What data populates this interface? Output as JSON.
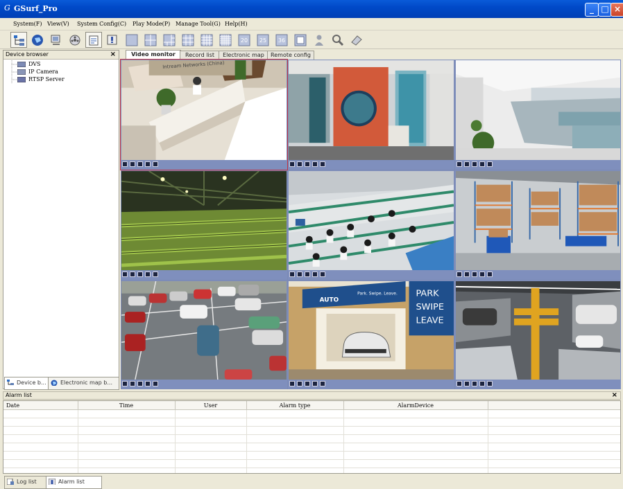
{
  "window": {
    "title": "GSurf_Pro",
    "controls": [
      "minimize",
      "maximize",
      "close"
    ]
  },
  "menu": {
    "items": [
      "System(F)",
      "View(V)",
      "System Config(C)",
      "Play Mode(P)",
      "Manage Tool(G)",
      "Help(H)"
    ]
  },
  "toolbar": {
    "buttons": [
      {
        "icon": "device-tree-icon"
      },
      {
        "icon": "globe-icon"
      },
      {
        "icon": "monitor-icon"
      },
      {
        "icon": "film-reel-icon"
      },
      {
        "icon": "config-icon"
      },
      {
        "icon": "alarm-panel-icon"
      },
      {
        "icon": "layout-1-icon"
      },
      {
        "icon": "layout-4-icon"
      },
      {
        "icon": "layout-6-icon"
      },
      {
        "icon": "layout-9-icon"
      },
      {
        "icon": "layout-16-icon"
      },
      {
        "icon": "layout-20-icon",
        "label": "20"
      },
      {
        "icon": "layout-25-icon",
        "label": "25"
      },
      {
        "icon": "layout-36-icon",
        "label": "36"
      },
      {
        "icon": "fullscreen-icon"
      },
      {
        "icon": "person-icon"
      },
      {
        "icon": "search-icon"
      },
      {
        "icon": "eraser-icon"
      }
    ]
  },
  "device_browser": {
    "title": "Device browser",
    "close": "×",
    "tree": [
      "DVS",
      "IP Camera",
      "RTSP Server"
    ],
    "tabs": [
      "Device b...",
      "Electronic map b..."
    ]
  },
  "video": {
    "tabs": [
      "Video monitor",
      "Record list",
      "Electronic map",
      "Remote config"
    ],
    "active_tab": "Video monitor",
    "cells": [
      {
        "scene": "reception",
        "label": "Intream Networks (China)"
      },
      {
        "scene": "lobby"
      },
      {
        "scene": "office"
      },
      {
        "scene": "warehouse"
      },
      {
        "scene": "factory"
      },
      {
        "scene": "storage"
      },
      {
        "scene": "parking-lot"
      },
      {
        "scene": "parking-garage",
        "sign_brand": "AUTO",
        "sign_slogan": "Park. Swipe. Leave.",
        "big_sign": [
          "PARK",
          "SWIPE",
          "LEAVE"
        ]
      },
      {
        "scene": "garage-lift"
      }
    ]
  },
  "alarm_list": {
    "title": "Alarm list",
    "close": "×",
    "columns": [
      "Date",
      "Time",
      "User",
      "Alarm type",
      "AlarmDevice",
      ""
    ],
    "rows": []
  },
  "bottom_tabs": [
    "Log list",
    "Alarm list"
  ]
}
